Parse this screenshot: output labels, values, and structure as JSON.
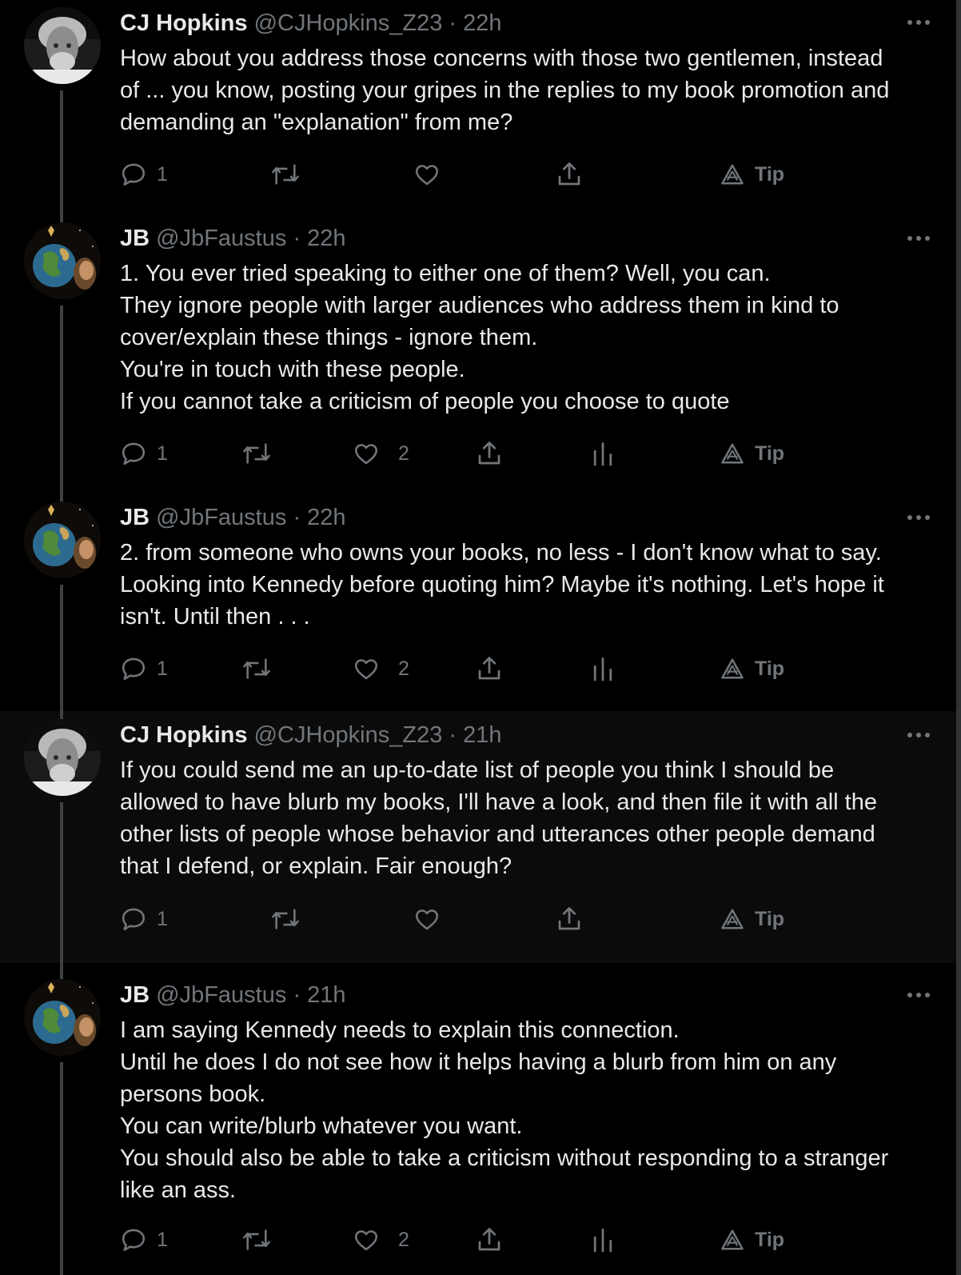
{
  "tweets": [
    {
      "name": "CJ Hopkins",
      "handle": "@CJHopkins_Z23",
      "separator": "·",
      "time": "22h",
      "avatar": "cj-avatar",
      "lines": [
        "How about you address those concerns with those two gentlemen, instead",
        "of ... you know, posting your gripes in the replies to my book promotion and",
        "demanding an \"explanation\" from me?"
      ],
      "reply_count": "1",
      "like_count": "",
      "tip_label": "Tip"
    },
    {
      "name": "JB",
      "handle": "@JbFaustus",
      "separator": "·",
      "time": "22h",
      "avatar": "jb-avatar",
      "lines": [
        "1. You ever tried speaking to either one of them? Well, you can.",
        "They ignore people with larger audiences who address them in kind to",
        "cover/explain these things - ignore them.",
        "You're in touch with these people.",
        "If you cannot take a criticism of people you choose to quote"
      ],
      "reply_count": "1",
      "like_count": "2",
      "tip_label": "Tip"
    },
    {
      "name": "JB",
      "handle": "@JbFaustus",
      "separator": "·",
      "time": "22h",
      "avatar": "jb-avatar",
      "lines": [
        "2.  from someone who owns your books, no less - I don't know what to say.",
        "Looking into Kennedy before quoting him? Maybe it's nothing. Let's hope it",
        "isn't. Until then . . ."
      ],
      "reply_count": "1",
      "like_count": "2",
      "tip_label": "Tip"
    },
    {
      "name": "CJ Hopkins",
      "handle": "@CJHopkins_Z23",
      "separator": "·",
      "time": "21h",
      "avatar": "cj-avatar",
      "lines": [
        "If you could send me an up-to-date list of people you think I should be",
        "allowed to have blurb my books, I'll have a look, and then file it with all the",
        "other lists of people whose behavior and utterances other people demand",
        "that I defend, or explain. Fair enough?"
      ],
      "reply_count": "1",
      "like_count": "",
      "tip_label": "Tip"
    },
    {
      "name": "JB",
      "handle": "@JbFaustus",
      "separator": "·",
      "time": "21h",
      "avatar": "jb-avatar",
      "lines": [
        "I am saying Kennedy needs to explain this connection.",
        "Until he does I do not see how it helps having a blurb from him on any",
        "persons book.",
        "You can write/blurb whatever you want.",
        "You should also be able to take a criticism without responding to a stranger",
        "like an ass."
      ],
      "reply_count": "1",
      "like_count": "2",
      "tip_label": "Tip"
    }
  ],
  "colors": {
    "background": "#000000",
    "highlight_background": "#0b0b0b",
    "text_primary": "#e7e9ea",
    "text_secondary": "#71767b",
    "thread_line": "#3e4144"
  },
  "icons": [
    "reply-icon",
    "retweet-icon",
    "like-icon",
    "share-icon",
    "analytics-icon",
    "tip-icon",
    "more-icon"
  ]
}
